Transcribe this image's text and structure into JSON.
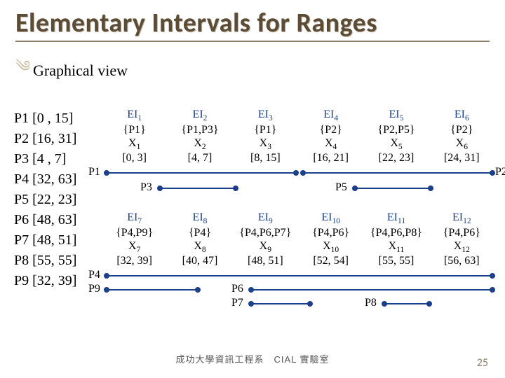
{
  "title": "Elementary Intervals for Ranges",
  "bullet": "Graphical view",
  "ranges": [
    "P1 [0 , 15]",
    "P2 [16, 31]",
    "P3 [4 ,  7]",
    "P4 [32, 63]",
    "P5 [22, 23]",
    "P6 [48, 63]",
    "P7 [48, 51]",
    "P8 [55, 55]",
    "P9 [32, 39]"
  ],
  "ei_top": [
    {
      "hdr": "EI",
      "sub": "1",
      "set": "{P1}",
      "x": "X",
      "xs": "1",
      "rng": "[0, 3]"
    },
    {
      "hdr": "EI",
      "sub": "2",
      "set": "{P1,P3}",
      "x": "X",
      "xs": "2",
      "rng": "[4, 7]"
    },
    {
      "hdr": "EI",
      "sub": "3",
      "set": "{P1}",
      "x": "X",
      "xs": "3",
      "rng": "[8, 15]"
    },
    {
      "hdr": "EI",
      "sub": "4",
      "set": "{P2}",
      "x": "X",
      "xs": "4",
      "rng": "[16, 21]"
    },
    {
      "hdr": "EI",
      "sub": "5",
      "set": "{P2,P5}",
      "x": "X",
      "xs": "5",
      "rng": "[22, 23]"
    },
    {
      "hdr": "EI",
      "sub": "6",
      "set": "{P2}",
      "x": "X",
      "xs": "6",
      "rng": "[24, 31]"
    }
  ],
  "ei_bot": [
    {
      "hdr": "EI",
      "sub": "7",
      "set": "{P4,P9}",
      "x": "X",
      "xs": "7",
      "rng": "[32, 39]"
    },
    {
      "hdr": "EI",
      "sub": "8",
      "set": "{P4}",
      "x": "X",
      "xs": "8",
      "rng": "[40, 47]"
    },
    {
      "hdr": "EI",
      "sub": "9",
      "set": "{P4,P6,P7}",
      "x": "X",
      "xs": "9",
      "rng": "[48, 51]"
    },
    {
      "hdr": "EI",
      "sub": "10",
      "set": "{P4,P6}",
      "x": "X",
      "xs": "10",
      "rng": "[52, 54]"
    },
    {
      "hdr": "EI",
      "sub": "11",
      "set": "{P4,P6,P8}",
      "x": "X",
      "xs": "11",
      "rng": "[55, 55]"
    },
    {
      "hdr": "EI",
      "sub": "12",
      "set": "{P4,P6}",
      "x": "X",
      "xs": "12",
      "rng": "[56, 63]"
    }
  ],
  "seg_labels": {
    "p1": "P1",
    "p2": "P2",
    "p3": "P3",
    "p4": "P4",
    "p5": "P5",
    "p6": "P6",
    "p7": "P7",
    "p8": "P8",
    "p9": "P9"
  },
  "footer": "成功大學資訊工程系　CIAL 實驗室",
  "page": "25"
}
